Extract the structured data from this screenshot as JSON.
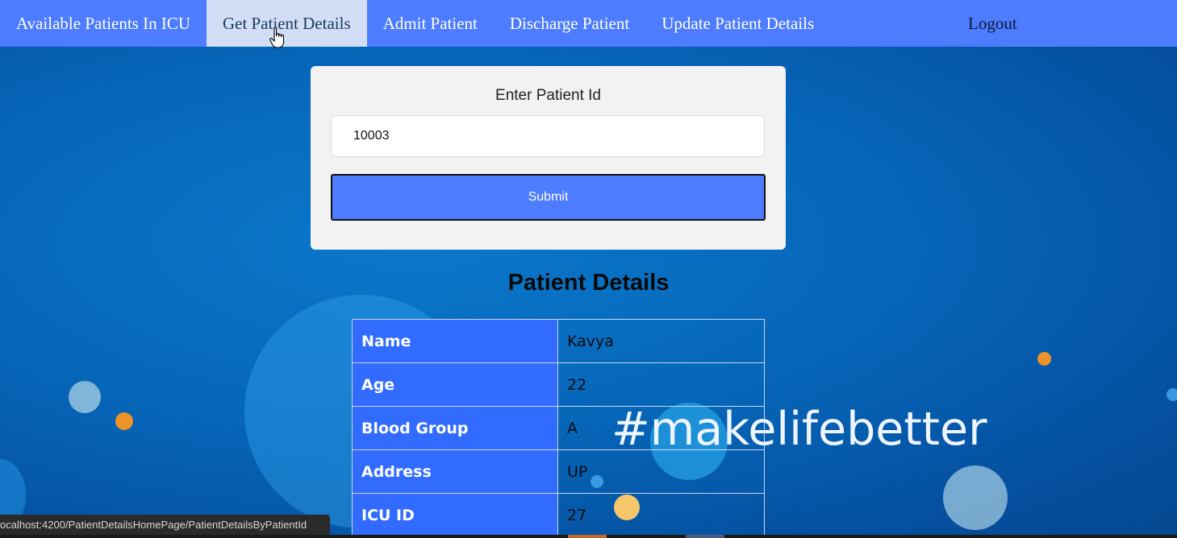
{
  "nav": {
    "items": [
      {
        "label": "Available Patients In ICU"
      },
      {
        "label": "Get Patient Details"
      },
      {
        "label": "Admit Patient"
      },
      {
        "label": "Discharge Patient"
      },
      {
        "label": "Update Patient Details"
      }
    ],
    "logout": "Logout"
  },
  "form": {
    "label": "Enter Patient Id",
    "patient_id_value": "10003",
    "submit_label": "Submit"
  },
  "details": {
    "title": "Patient Details",
    "rows": [
      {
        "key": "Name",
        "value": "Kavya"
      },
      {
        "key": "Age",
        "value": "22"
      },
      {
        "key": "Blood Group",
        "value": "A"
      },
      {
        "key": "Address",
        "value": "UP"
      },
      {
        "key": "ICU ID",
        "value": "27"
      }
    ]
  },
  "background_text": "#makelifebetter",
  "status_bar": "ocalhost:4200/PatientDetailsHomePage/PatientDetailsByPatientId",
  "colors": {
    "nav": "#4d7cfe",
    "nav_active": "#d2def5",
    "table_key": "#316bff",
    "submit": "#4d7cfe"
  }
}
